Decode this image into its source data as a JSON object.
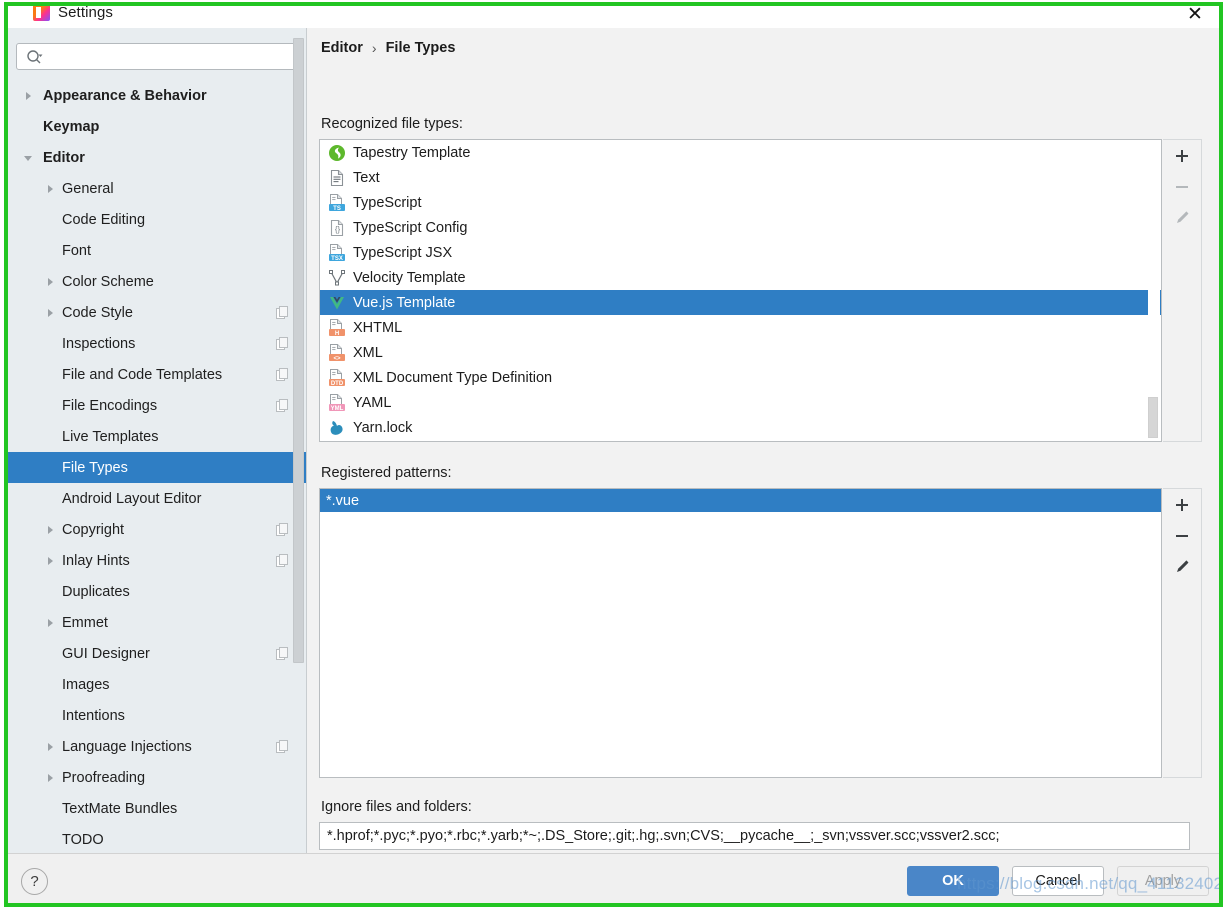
{
  "window": {
    "title": "Settings",
    "app_icon": "intellij-idea-icon",
    "close_label": "✕"
  },
  "search": {
    "value": "",
    "placeholder": "",
    "icon": "search-icon"
  },
  "sidebar": {
    "items": [
      {
        "label": "Appearance & Behavior",
        "indent": 0,
        "arrow": "collapsed",
        "bold": true,
        "badge": false,
        "selected": false
      },
      {
        "label": "Keymap",
        "indent": 0,
        "arrow": "none",
        "bold": true,
        "badge": false,
        "selected": false
      },
      {
        "label": "Editor",
        "indent": 0,
        "arrow": "expanded",
        "bold": true,
        "badge": false,
        "selected": false
      },
      {
        "label": "General",
        "indent": 1,
        "arrow": "collapsed",
        "bold": false,
        "badge": false,
        "selected": false
      },
      {
        "label": "Code Editing",
        "indent": 1,
        "arrow": "none",
        "bold": false,
        "badge": false,
        "selected": false
      },
      {
        "label": "Font",
        "indent": 1,
        "arrow": "none",
        "bold": false,
        "badge": false,
        "selected": false
      },
      {
        "label": "Color Scheme",
        "indent": 1,
        "arrow": "collapsed",
        "bold": false,
        "badge": false,
        "selected": false
      },
      {
        "label": "Code Style",
        "indent": 1,
        "arrow": "collapsed",
        "bold": false,
        "badge": true,
        "selected": false
      },
      {
        "label": "Inspections",
        "indent": 1,
        "arrow": "none",
        "bold": false,
        "badge": true,
        "selected": false
      },
      {
        "label": "File and Code Templates",
        "indent": 1,
        "arrow": "none",
        "bold": false,
        "badge": true,
        "selected": false
      },
      {
        "label": "File Encodings",
        "indent": 1,
        "arrow": "none",
        "bold": false,
        "badge": true,
        "selected": false
      },
      {
        "label": "Live Templates",
        "indent": 1,
        "arrow": "none",
        "bold": false,
        "badge": false,
        "selected": false
      },
      {
        "label": "File Types",
        "indent": 1,
        "arrow": "none",
        "bold": false,
        "badge": false,
        "selected": true
      },
      {
        "label": "Android Layout Editor",
        "indent": 1,
        "arrow": "none",
        "bold": false,
        "badge": false,
        "selected": false
      },
      {
        "label": "Copyright",
        "indent": 1,
        "arrow": "collapsed",
        "bold": false,
        "badge": true,
        "selected": false
      },
      {
        "label": "Inlay Hints",
        "indent": 1,
        "arrow": "collapsed",
        "bold": false,
        "badge": true,
        "selected": false
      },
      {
        "label": "Duplicates",
        "indent": 1,
        "arrow": "none",
        "bold": false,
        "badge": false,
        "selected": false
      },
      {
        "label": "Emmet",
        "indent": 1,
        "arrow": "collapsed",
        "bold": false,
        "badge": false,
        "selected": false
      },
      {
        "label": "GUI Designer",
        "indent": 1,
        "arrow": "none",
        "bold": false,
        "badge": true,
        "selected": false
      },
      {
        "label": "Images",
        "indent": 1,
        "arrow": "none",
        "bold": false,
        "badge": false,
        "selected": false
      },
      {
        "label": "Intentions",
        "indent": 1,
        "arrow": "none",
        "bold": false,
        "badge": false,
        "selected": false
      },
      {
        "label": "Language Injections",
        "indent": 1,
        "arrow": "collapsed",
        "bold": false,
        "badge": true,
        "selected": false
      },
      {
        "label": "Proofreading",
        "indent": 1,
        "arrow": "collapsed",
        "bold": false,
        "badge": false,
        "selected": false
      },
      {
        "label": "TextMate Bundles",
        "indent": 1,
        "arrow": "none",
        "bold": false,
        "badge": false,
        "selected": false
      },
      {
        "label": "TODO",
        "indent": 1,
        "arrow": "none",
        "bold": false,
        "badge": false,
        "selected": false
      }
    ]
  },
  "breadcrumb": {
    "parent": "Editor",
    "separator": "›",
    "current": "File Types"
  },
  "main": {
    "recognized_label": "Recognized file types:",
    "patterns_label": "Registered patterns:",
    "ignore_label": "Ignore files and folders:",
    "ignore_value": "*.hprof;*.pyc;*.pyo;*.rbc;*.yarb;*~;.DS_Store;.git;.hg;.svn;CVS;__pycache__;_svn;vssver.scc;vssver2.scc;",
    "file_types": [
      {
        "label": "Tapestry Template",
        "icon": "tapestry-icon",
        "selected": false
      },
      {
        "label": "Text",
        "icon": "text-file-icon",
        "selected": false
      },
      {
        "label": "TypeScript",
        "icon": "typescript-icon",
        "selected": false
      },
      {
        "label": "TypeScript Config",
        "icon": "tsconfig-icon",
        "selected": false
      },
      {
        "label": "TypeScript JSX",
        "icon": "typescript-jsx-icon",
        "selected": false
      },
      {
        "label": "Velocity Template",
        "icon": "velocity-icon",
        "selected": false
      },
      {
        "label": "Vue.js Template",
        "icon": "vuejs-icon",
        "selected": true
      },
      {
        "label": "XHTML",
        "icon": "xhtml-icon",
        "selected": false
      },
      {
        "label": "XML",
        "icon": "xml-icon",
        "selected": false
      },
      {
        "label": "XML Document Type Definition",
        "icon": "dtd-icon",
        "selected": false
      },
      {
        "label": "YAML",
        "icon": "yaml-icon",
        "selected": false
      },
      {
        "label": "Yarn.lock",
        "icon": "yarn-icon",
        "selected": false
      }
    ],
    "patterns": [
      {
        "label": "*.vue",
        "selected": true
      }
    ],
    "toolbar_filetypes": [
      {
        "name": "add",
        "glyph": "+",
        "enabled": true
      },
      {
        "name": "remove",
        "glyph": "−",
        "enabled": false
      },
      {
        "name": "edit",
        "glyph": "pencil",
        "enabled": false
      }
    ],
    "toolbar_patterns": [
      {
        "name": "add",
        "glyph": "+",
        "enabled": true
      },
      {
        "name": "remove",
        "glyph": "−",
        "enabled": true
      },
      {
        "name": "edit",
        "glyph": "pencil",
        "enabled": true
      }
    ]
  },
  "footer": {
    "help_label": "?",
    "ok_label": "OK",
    "cancel_label": "Cancel",
    "apply_label": "Apply"
  },
  "watermark": {
    "text": "https://blog.csdn.net/qq_41132402"
  },
  "colors": {
    "selection_blue": "#2f7ec4",
    "annotation_green": "#22c522",
    "sidebar_bg": "#e8edf0",
    "panel_bg": "#f2f2f2",
    "ok_button": "#4a86c8"
  }
}
